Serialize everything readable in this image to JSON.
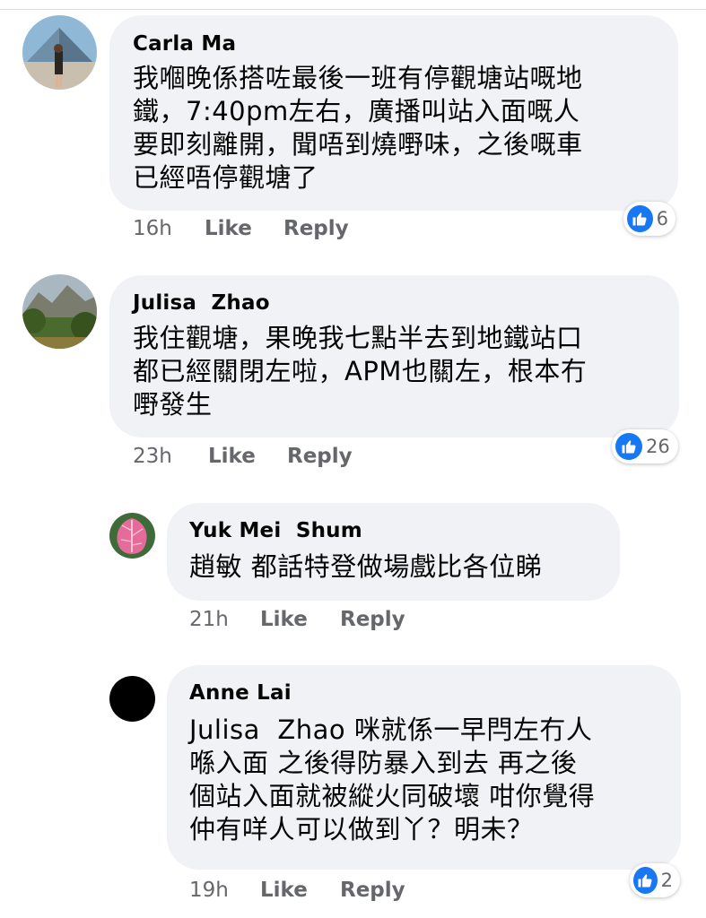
{
  "comments": [
    {
      "author": "Carla Ma",
      "text": "我嗰晚係搭咗最後一班有停觀塘站嘅地\n鐵，7:40pm左右，廣播叫站入面嘅人\n要即刻離開，聞唔到燒嘢味，之後嘅車\n已經唔停觀塘了",
      "time": "16h",
      "like_label": "Like",
      "reply_label": "Reply",
      "reactions": "6",
      "avatar": "louvre-pyramid-photo"
    },
    {
      "author": "Julisa  Zhao",
      "text": "我住觀塘，果晚我七點半去到地鐵站口\n都已經關閉左啦，APM也關左，根本冇\n嘢發生",
      "time": "23h",
      "like_label": "Like",
      "reply_label": "Reply",
      "reactions": "26",
      "avatar": "mountain-landscape-photo"
    },
    {
      "author": "Yuk Mei  Shum",
      "text": "趙敏 都話特登做場戲比各位睇",
      "time": "21h",
      "like_label": "Like",
      "reply_label": "Reply",
      "avatar": "pink-leaf-photo"
    },
    {
      "author": "Anne Lai",
      "text": "Julisa  Zhao 咪就係一早閂左冇人\n喺入面 之後得防暴入到去 再之後\n個站入面就被縱火同破壞 咁你覺得\n仲有咩人可以做到丫？明未？",
      "time": "19h",
      "like_label": "Like",
      "reply_label": "Reply",
      "reactions": "2",
      "avatar": "black-circle"
    }
  ],
  "colors": {
    "bubble": "#f0f2f5",
    "like_blue": "#1877f2",
    "meta_gray": "#65676b"
  },
  "icons": [
    "thumbs-up-icon"
  ]
}
